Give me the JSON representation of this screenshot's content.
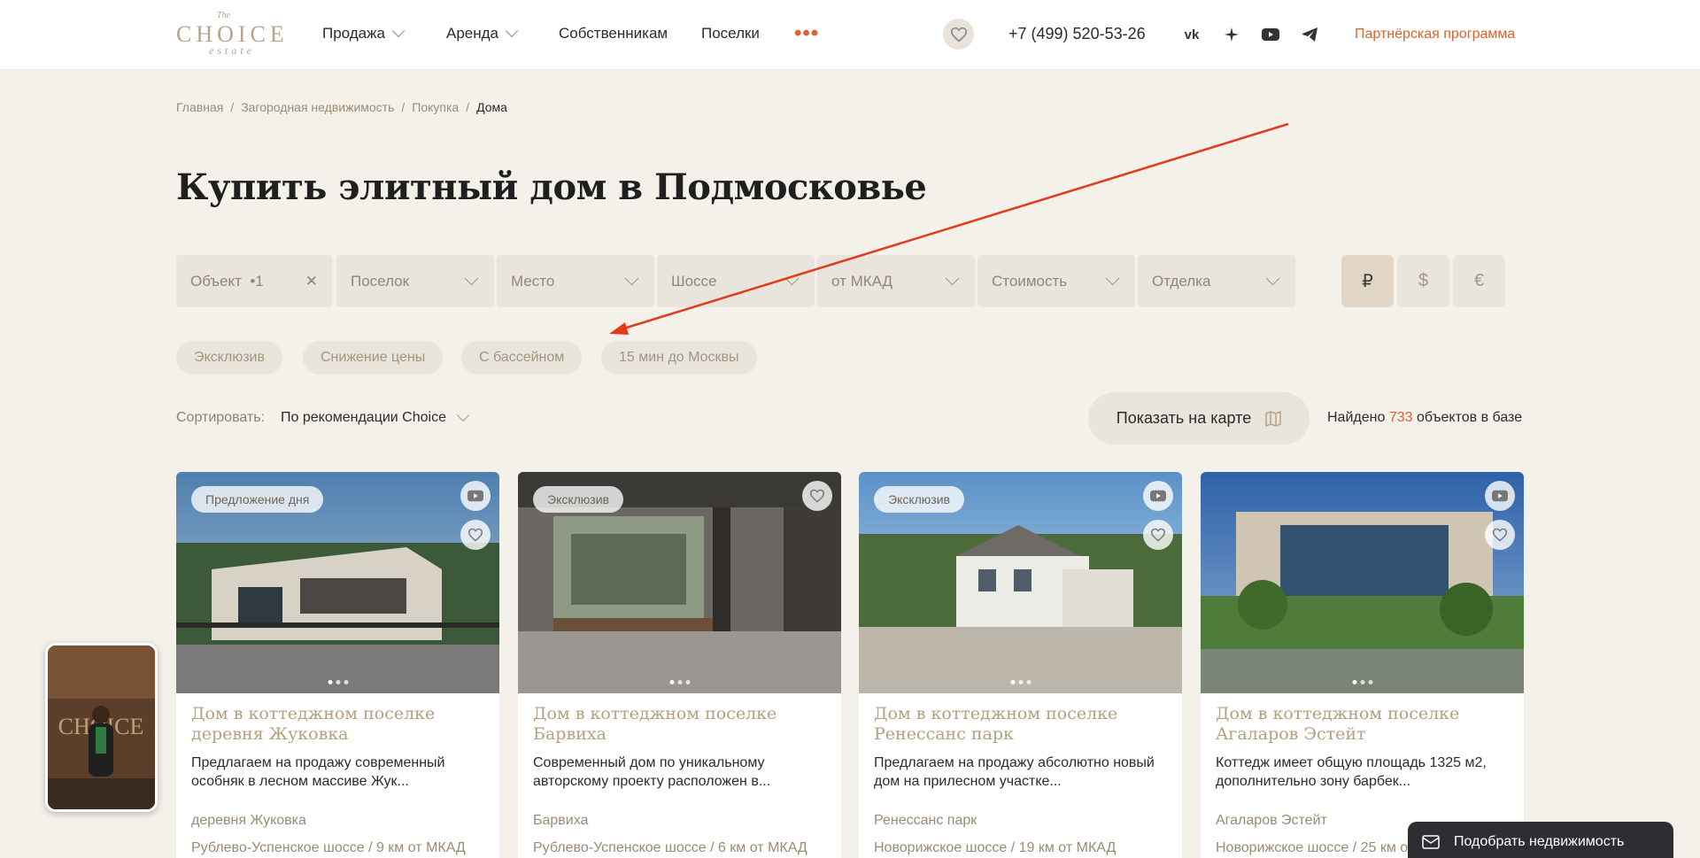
{
  "brand": {
    "the": "The",
    "name": "CHOICE",
    "sub": "estate"
  },
  "nav": {
    "sale": "Продажа",
    "rent": "Аренда",
    "owners": "Собственникам",
    "villages": "Поселки",
    "more": "•••",
    "phone": "+7 (499) 520-53-26",
    "partner": "Партнёрская программа"
  },
  "breadcrumb": [
    "Главная",
    "Загородная недвижимость",
    "Покупка",
    "Дома"
  ],
  "title": "Купить элитный дом в Подмосковье",
  "filters": {
    "object": "Объект",
    "object_count": "•1",
    "village": "Поселок",
    "place": "Место",
    "highway": "Шоссе",
    "mkad": "от МКАД",
    "price": "Стоимость",
    "finish": "Отделка"
  },
  "currencies": [
    "₽",
    "$",
    "€"
  ],
  "chips": [
    "Эксклюзив",
    "Снижение цены",
    "С бассейном",
    "15 мин до Москвы"
  ],
  "sort": {
    "label": "Сортировать:",
    "value": "По рекомендации Choice"
  },
  "map_button": "Показать на карте",
  "found": {
    "prefix": "Найдено",
    "count": "733",
    "suffix": "объектов в базе"
  },
  "cards": [
    {
      "badge": "Предложение дня",
      "title": "Дом в коттеджном поселке деревня Жуковка",
      "desc": "Предлагаем на продажу современный особняк в лесном массиве Жук...",
      "location": "деревня Жуковка",
      "road": "Рублево-Успенское шоссе / 9 км от МКАД"
    },
    {
      "badge": "Эксклюзив",
      "title": "Дом в коттеджном поселке Барвиха",
      "desc": "Современный дом по уникальному авторскому проекту расположен в...",
      "location": "Барвиха",
      "road": "Рублево-Успенское шоссе / 6 км от МКАД"
    },
    {
      "badge": "Эксклюзив",
      "title": "Дом в коттеджном поселке Ренессанс парк",
      "desc": "Предлагаем на продажу абсолютно новый дом на прилесном участке...",
      "location": "Ренессанс парк",
      "road": "Новорижское шоссе / 19 км от МКАД"
    },
    {
      "badge": "",
      "title": "Дом в коттеджном поселке Агаларов Эстейт",
      "desc": "Коттедж имеет общую площадь 1325 м2, дополнительно зону барбек...",
      "location": "Агаларов Эстейт",
      "road": "Новорижское шоссе / 25 км от МКАД"
    }
  ],
  "pick_widget": "Подобрать недвижимость",
  "colors": {
    "accent": "#e2612b",
    "gold": "#b49f7f",
    "bg": "#f4f1ea"
  }
}
